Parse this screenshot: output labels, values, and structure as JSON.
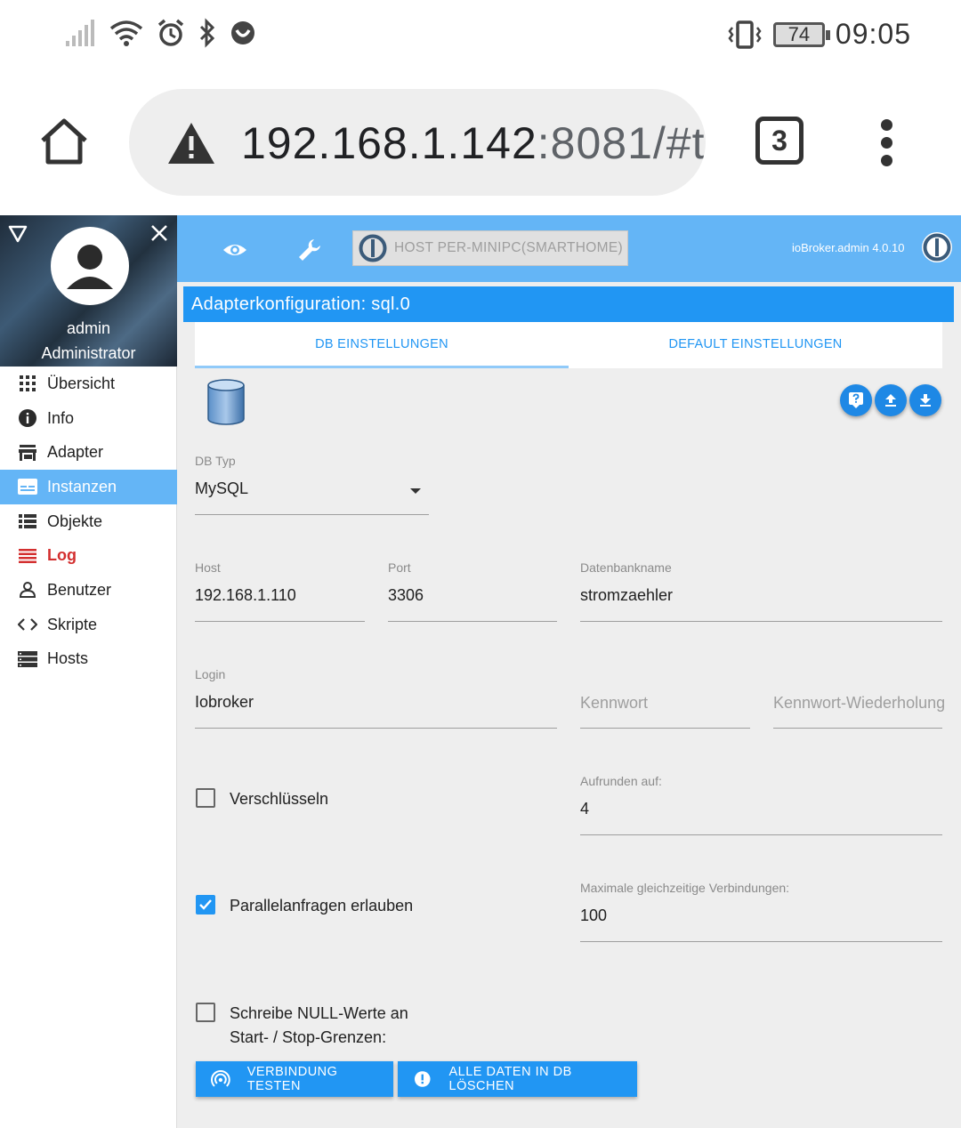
{
  "statusbar": {
    "battery": "74",
    "time": "09:05"
  },
  "browser": {
    "url_host": "192.168.1.142",
    "url_rest": ":8081/#t",
    "tab_count": "3"
  },
  "sidebar": {
    "user_name": "admin",
    "user_role": "Administrator",
    "items": [
      {
        "label": "Übersicht",
        "icon": "apps-grid-icon"
      },
      {
        "label": "Info",
        "icon": "info-icon"
      },
      {
        "label": "Adapter",
        "icon": "store-icon"
      },
      {
        "label": "Instanzen",
        "icon": "instances-icon"
      },
      {
        "label": "Objekte",
        "icon": "list-icon"
      },
      {
        "label": "Log",
        "icon": "log-icon"
      },
      {
        "label": "Benutzer",
        "icon": "user-icon"
      },
      {
        "label": "Skripte",
        "icon": "code-icon"
      },
      {
        "label": "Hosts",
        "icon": "hosts-icon"
      }
    ]
  },
  "topbar": {
    "host_label": "HOST PER-MINIPC(SMARTHOME)",
    "version": "ioBroker.admin 4.0.10"
  },
  "config": {
    "title": "Adapterkonfiguration: sql.0",
    "tabs": [
      "DB EINSTELLUNGEN",
      "DEFAULT EINSTELLUNGEN"
    ],
    "db_type": {
      "label": "DB Typ",
      "value": "MySQL"
    },
    "host": {
      "label": "Host",
      "value": "192.168.1.110"
    },
    "port": {
      "label": "Port",
      "value": "3306"
    },
    "dbname": {
      "label": "Datenbankname",
      "value": "stromzaehler"
    },
    "login": {
      "label": "Login",
      "value": "Iobroker"
    },
    "password": {
      "placeholder": "Kennwort"
    },
    "password_repeat": {
      "placeholder": "Kennwort-Wiederholung"
    },
    "encrypt": {
      "label": "Verschlüsseln",
      "checked": false
    },
    "round": {
      "label": "Aufrunden auf:",
      "value": "4"
    },
    "parallel": {
      "label": "Parallelanfragen erlauben",
      "checked": true
    },
    "max_conn": {
      "label": "Maximale gleichzeitige Verbindungen:",
      "value": "100"
    },
    "write_null": {
      "line1": "Schreibe NULL-Werte an",
      "line2": "Start- / Stop-Grenzen:",
      "checked": false
    },
    "btn_test": "VERBINDUNG TESTEN",
    "btn_delete": "ALLE DATEN IN DB LÖSCHEN"
  },
  "colors": {
    "primary": "#2196f3",
    "topbar": "#64b5f6",
    "active_nav": "#64b5f6",
    "log_red": "#d32f2f"
  }
}
